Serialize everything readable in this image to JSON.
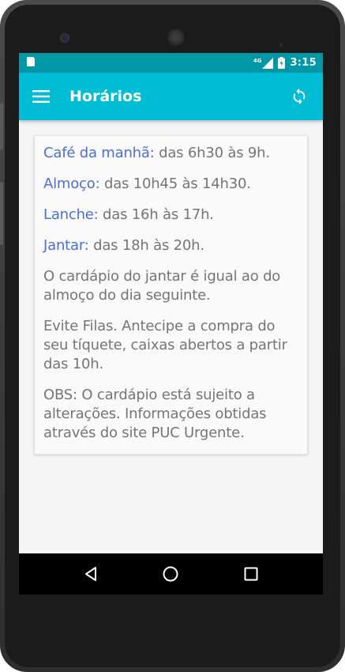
{
  "status_bar": {
    "network_label": "4G",
    "time": "3:15",
    "icons": [
      "sd-card-icon",
      "signal-icon",
      "battery-icon"
    ]
  },
  "app_bar": {
    "title": "Horários",
    "menu_icon": "hamburger-menu-icon",
    "refresh_icon": "refresh-icon",
    "color": "#00bcd4",
    "status_color": "#0097a7"
  },
  "schedule": {
    "meals": [
      {
        "label": "Café da manhã:",
        "hours": "das 6h30 às 9h."
      },
      {
        "label": "Almoço:",
        "hours": "das 10h45 às 14h30."
      },
      {
        "label": "Lanche:",
        "hours": "das 16h às 17h."
      },
      {
        "label": "Jantar:",
        "hours": "das 18h às 20h."
      }
    ],
    "notes": [
      "O cardápio do jantar é igual ao do almoço do dia seguinte.",
      "Evite Filas. Antecipe a compra do seu tíquete, caixas abertos a partir das 10h.",
      "OBS: O cardápio está sujeito a alterações. Informações obtidas através do site PUC Urgente."
    ],
    "label_color": "#4a6fdc",
    "text_color": "#757575"
  },
  "nav_bar": {
    "icons": [
      "back-icon",
      "home-icon",
      "recents-icon"
    ]
  }
}
